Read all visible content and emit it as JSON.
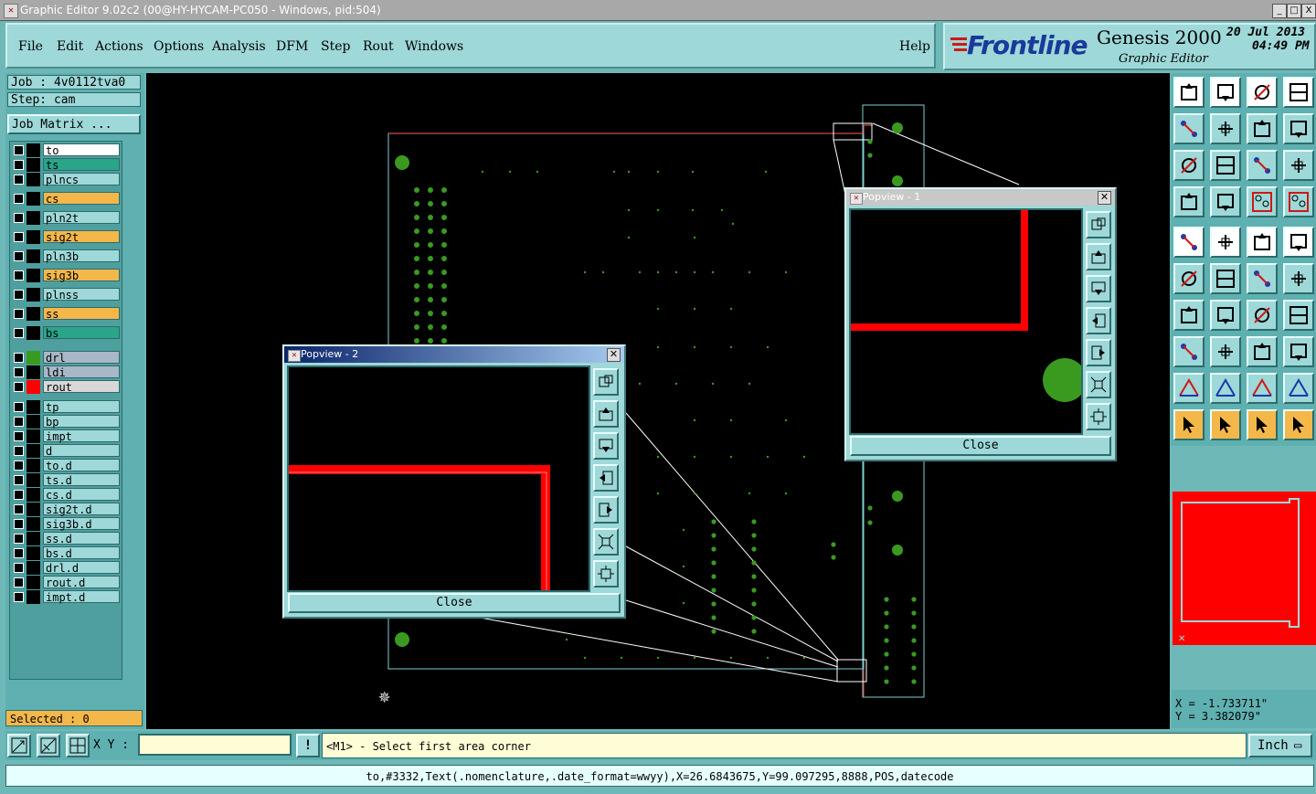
{
  "window": {
    "title": "Graphic Editor 9.02c2 (00@HY-HYCAM-PC050 - Windows, pid:504)",
    "btn_min": "_",
    "btn_max": "□",
    "btn_close": "X"
  },
  "menubar": {
    "items": [
      "File",
      "Edit",
      "Actions",
      "Options",
      "Analysis",
      "DFM",
      "Step",
      "Rout",
      "Windows"
    ],
    "help": "Help"
  },
  "logo": {
    "brand": "Frontline",
    "product": "Genesis 2000",
    "subtitle": "Graphic Editor",
    "date": "20 Jul 2013",
    "time": "04:49 PM"
  },
  "job": {
    "job_label": "Job : 4v0112tva0",
    "step_label": "Step: cam",
    "job_matrix": "Job Matrix ..."
  },
  "layers": [
    {
      "name": "to",
      "color": "#ffffff",
      "swatch": "#000000"
    },
    {
      "name": "ts",
      "color": "#2aa58a",
      "swatch": "#000000"
    },
    {
      "name": "plncs",
      "color": "#9ed8d8",
      "swatch": "#000000"
    },
    {
      "name": "cs",
      "color": "#f4b74a",
      "swatch": "#000000"
    },
    {
      "name": "pln2t",
      "color": "#9ed8d8",
      "swatch": "#000000"
    },
    {
      "name": "sig2t",
      "color": "#f4b74a",
      "swatch": "#000000"
    },
    {
      "name": "pln3b",
      "color": "#9ed8d8",
      "swatch": "#000000"
    },
    {
      "name": "sig3b",
      "color": "#f4b74a",
      "swatch": "#000000"
    },
    {
      "name": "plnss",
      "color": "#9ed8d8",
      "swatch": "#000000"
    },
    {
      "name": "ss",
      "color": "#f4b74a",
      "swatch": "#000000"
    },
    {
      "name": "bs",
      "color": "#2aa58a",
      "swatch": "#000000"
    },
    {
      "name": "drl",
      "color": "#a8b8c8",
      "swatch": "#3a9a20"
    },
    {
      "name": "ldi",
      "color": "#a8b8c8",
      "swatch": "#000000"
    },
    {
      "name": "rout",
      "color": "#d8d8d8",
      "swatch": "#ff0000"
    },
    {
      "name": "tp",
      "color": "#9ed8d8",
      "swatch": "#000000"
    },
    {
      "name": "bp",
      "color": "#9ed8d8",
      "swatch": "#000000"
    },
    {
      "name": "impt",
      "color": "#9ed8d8",
      "swatch": "#000000"
    },
    {
      "name": "d",
      "color": "#9ed8d8",
      "swatch": "#000000"
    },
    {
      "name": "to.d",
      "color": "#9ed8d8",
      "swatch": "#000000"
    },
    {
      "name": "ts.d",
      "color": "#9ed8d8",
      "swatch": "#000000"
    },
    {
      "name": "cs.d",
      "color": "#9ed8d8",
      "swatch": "#000000"
    },
    {
      "name": "sig2t.d",
      "color": "#9ed8d8",
      "swatch": "#000000"
    },
    {
      "name": "sig3b.d",
      "color": "#9ed8d8",
      "swatch": "#000000"
    },
    {
      "name": "ss.d",
      "color": "#9ed8d8",
      "swatch": "#000000"
    },
    {
      "name": "bs.d",
      "color": "#9ed8d8",
      "swatch": "#000000"
    },
    {
      "name": "drl.d",
      "color": "#9ed8d8",
      "swatch": "#000000"
    },
    {
      "name": "rout.d",
      "color": "#9ed8d8",
      "swatch": "#000000"
    },
    {
      "name": "impt.d",
      "color": "#9ed8d8",
      "swatch": "#000000"
    }
  ],
  "selected": "Selected : 0",
  "popview1": {
    "title": "Popview - 1",
    "close": "Close"
  },
  "popview2": {
    "title": "Popview - 2",
    "close": "Close"
  },
  "coords": {
    "x": "X = -1.733711\"",
    "y": "Y = 3.382079\""
  },
  "bottom": {
    "xy_label": "X Y :",
    "xy_value": "",
    "exclaim": "!",
    "message": "<M1> - Select first area corner",
    "units": "Inch"
  },
  "status": "to,#3332,Text(.nomenclature,.date_format=wwyy),X=26.6843675,Y=99.097295,8888,POS,datecode",
  "colors": {
    "background": "#6fb8b8",
    "canvas": "#000000",
    "pad": "#3a9a20",
    "rout": "#ff0000",
    "outline": "#7fd0d0"
  }
}
